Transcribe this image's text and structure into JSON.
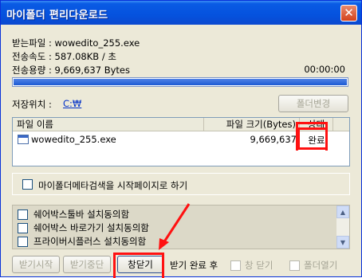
{
  "window": {
    "title": "마이폴더 편리다운로드"
  },
  "info": {
    "received_file": "받는파일 : wowedito_255.exe",
    "transfer_speed": "전송속도 : 587.08KB / 초",
    "transfer_amount": "전송용량 : 9,669,637 Bytes",
    "elapsed": "00:00:00",
    "progress": 1.0
  },
  "save": {
    "label": "저장위치 :",
    "path": "C:₩",
    "change_button": "폴더변경"
  },
  "file_table": {
    "columns": [
      "파일 이름",
      "파일 크기(Bytes)",
      "상태"
    ],
    "rows": [
      {
        "name": "wowedito_255.exe",
        "size": "9,669,637",
        "status": "완료"
      }
    ]
  },
  "meta_search": {
    "label": "마이폴더메타검색을 시작페이지로 하기",
    "checked": false
  },
  "offers": [
    {
      "label": "쉐어박스툴바 설치동의함",
      "checked": false
    },
    {
      "label": "쉐어박스 바로가기 설치동의함",
      "checked": false
    },
    {
      "label": "프라이버시플러스 설치동의함",
      "checked": false
    }
  ],
  "footer": {
    "start_button": "받기시작",
    "stop_button": "받기중단",
    "close_button": "창닫기",
    "after_label": "받기 완료 후",
    "close_option": "창 닫기",
    "open_folder_option": "폴더열기"
  },
  "colors": {
    "highlight": "#ff1111",
    "titlebar": "#0552de",
    "progress": "#1d5bd3"
  }
}
